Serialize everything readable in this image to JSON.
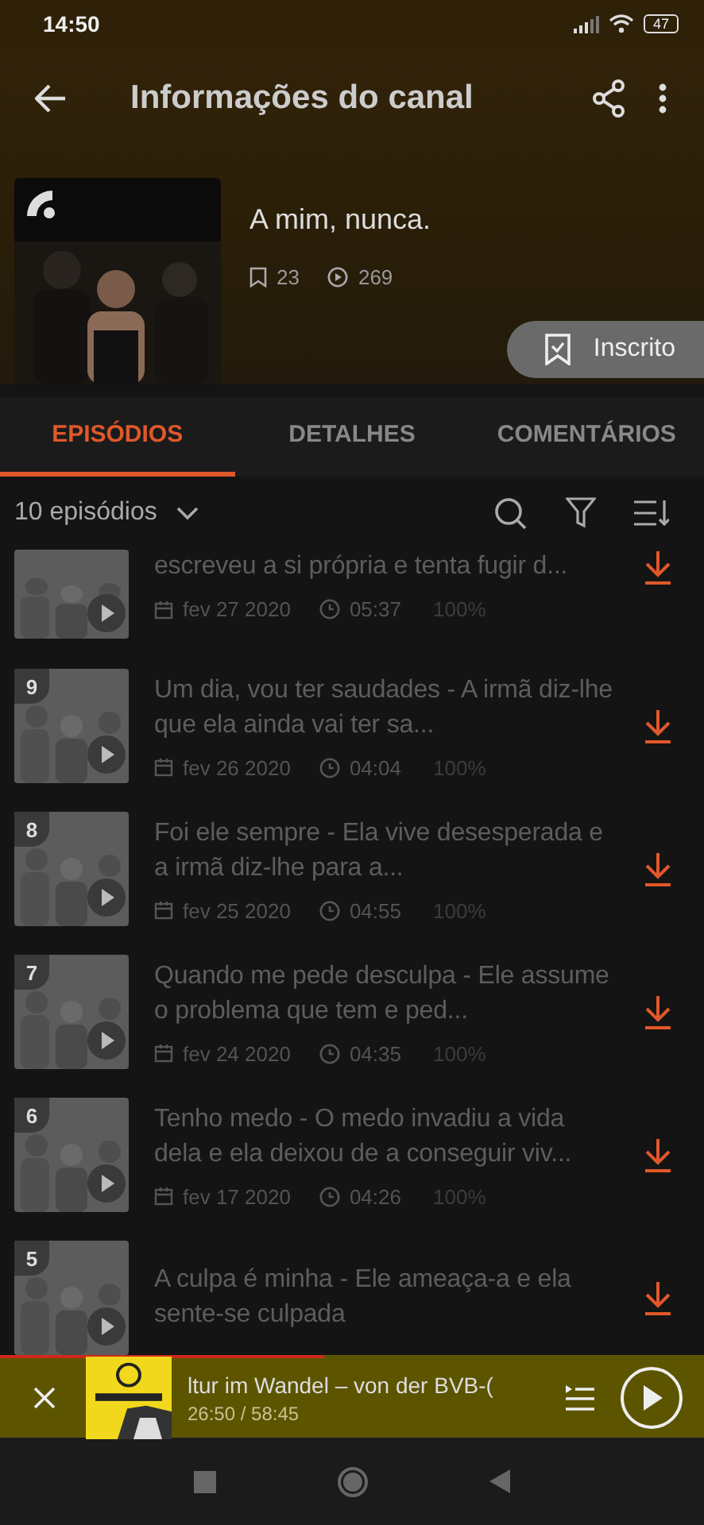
{
  "status_bar": {
    "time": "14:50",
    "battery": "47"
  },
  "header": {
    "title": "Informações do canal"
  },
  "channel": {
    "name": "A mim, nunca.",
    "subscribers": "23",
    "plays": "269",
    "subscribe_button": "Inscrito",
    "subscribed": true
  },
  "tabs": [
    {
      "label": "EPISÓDIOS",
      "selected": true
    },
    {
      "label": "DETALHES",
      "selected": false
    },
    {
      "label": "COMENTÁRIOS",
      "selected": false
    }
  ],
  "list_header": {
    "count": "10 episódios"
  },
  "episodes": [
    {
      "title": "escreveu a si própria e tenta fugir d...",
      "date": "fev 27 2020",
      "duration": "05:37",
      "progress": "100%"
    },
    {
      "number": "9",
      "title": "Um dia, vou ter saudades - A irmã diz-lhe que ela ainda vai ter sa...",
      "date": "fev 26 2020",
      "duration": "04:04",
      "progress": "100%"
    },
    {
      "number": "8",
      "title": "Foi ele sempre - Ela vive desesperada e a irmã diz-lhe para a...",
      "date": "fev 25 2020",
      "duration": "04:55",
      "progress": "100%"
    },
    {
      "number": "7",
      "title": "Quando me pede desculpa - Ele assume o problema que tem e ped...",
      "date": "fev 24 2020",
      "duration": "04:35",
      "progress": "100%"
    },
    {
      "number": "6",
      "title": "Tenho medo - O medo invadiu a vida dela e ela deixou de a conseguir viv...",
      "date": "fev 17 2020",
      "duration": "04:26",
      "progress": "100%"
    },
    {
      "number": "5",
      "title": "A culpa é minha - Ele ameaça-a e ela sente-se culpada"
    }
  ],
  "player": {
    "title": "ltur im Wandel – von der BVB-(",
    "time": "26:50 / 58:45",
    "level": 0.46
  }
}
